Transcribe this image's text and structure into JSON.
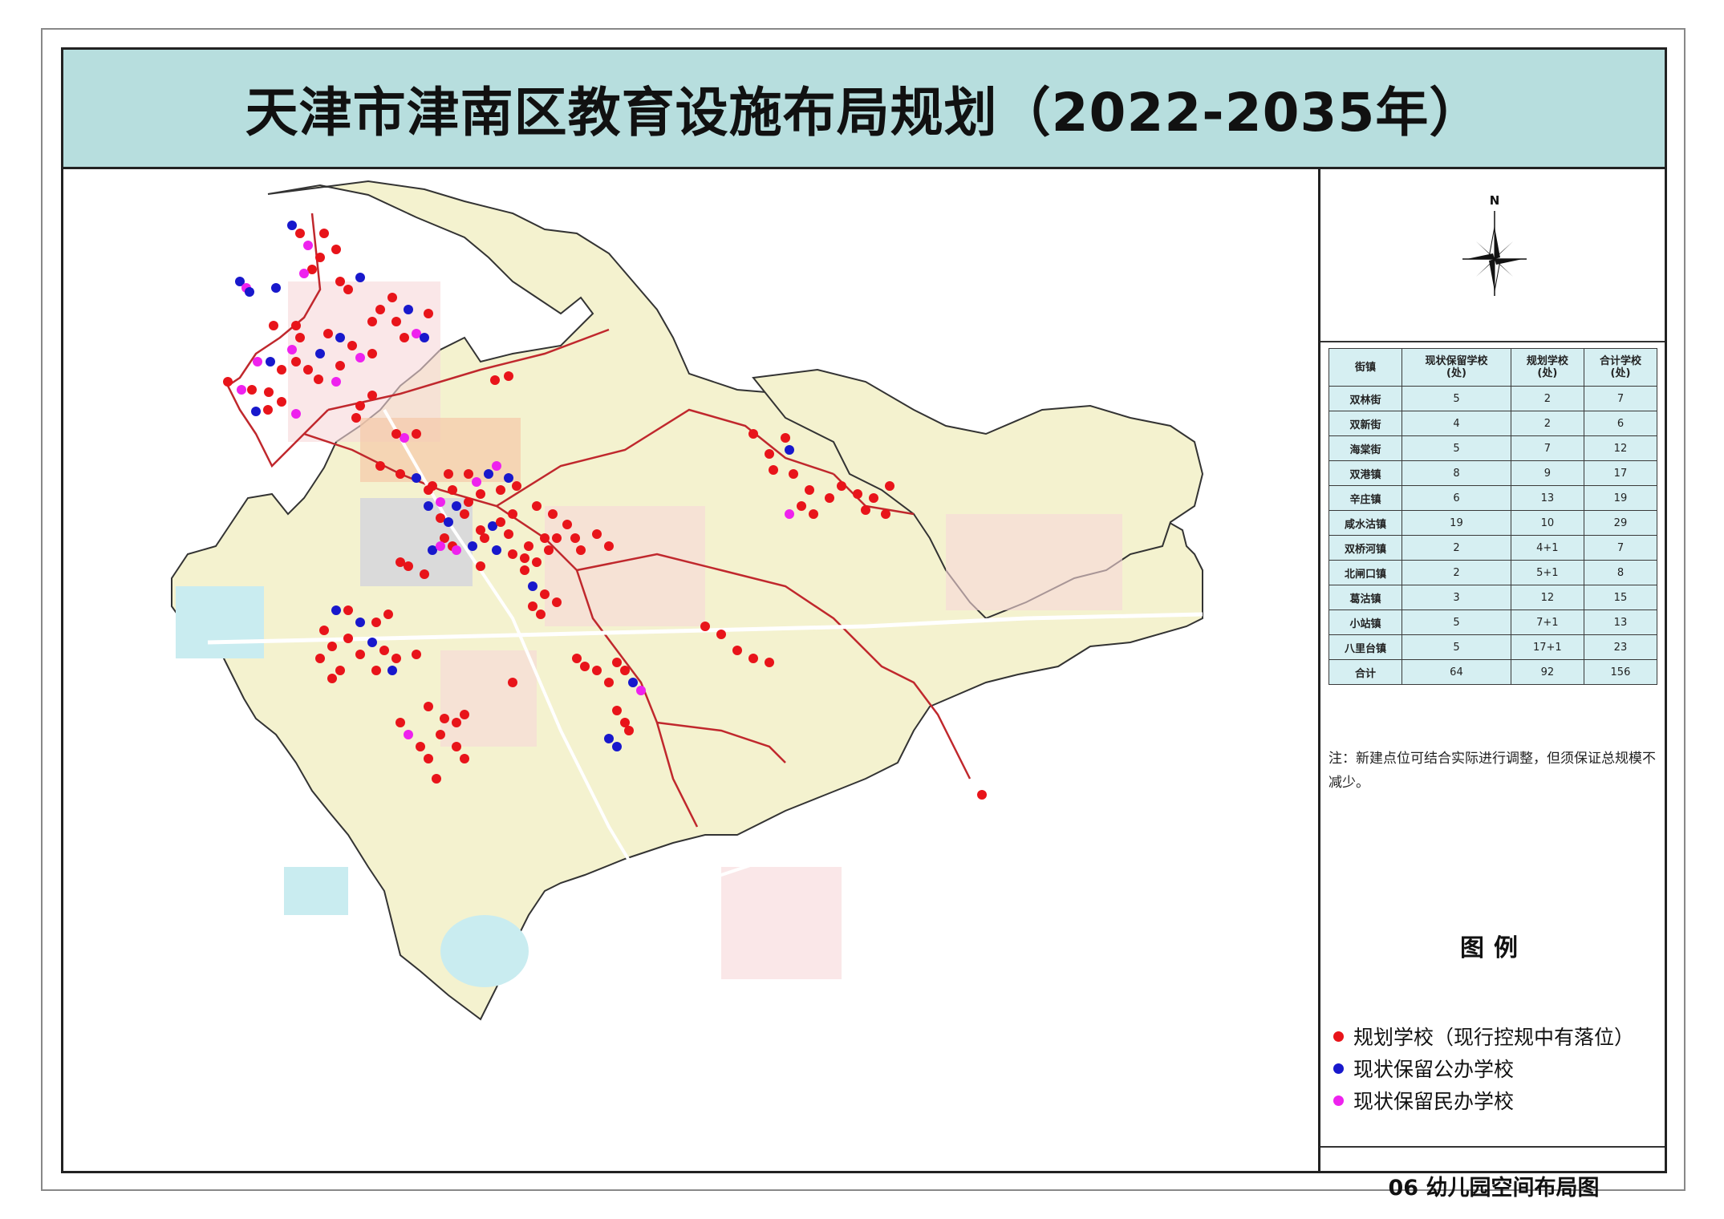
{
  "title": "天津市津南区教育设施布局规划（2022-2035年）",
  "compass": {
    "north_label": "N",
    "icon": "north-arrow-icon"
  },
  "table": {
    "headers": [
      "街镇",
      "现状保留学校\n(处)",
      "规划学校\n(处)",
      "合计学校\n(处)"
    ],
    "rows": [
      [
        "双林街",
        "5",
        "2",
        "7"
      ],
      [
        "双新街",
        "4",
        "2",
        "6"
      ],
      [
        "海棠街",
        "5",
        "7",
        "12"
      ],
      [
        "双港镇",
        "8",
        "9",
        "17"
      ],
      [
        "辛庄镇",
        "6",
        "13",
        "19"
      ],
      [
        "咸水沽镇",
        "19",
        "10",
        "29"
      ],
      [
        "双桥河镇",
        "2",
        "4+1",
        "7"
      ],
      [
        "北闸口镇",
        "2",
        "5+1",
        "8"
      ],
      [
        "葛沽镇",
        "3",
        "12",
        "15"
      ],
      [
        "小站镇",
        "5",
        "7+1",
        "13"
      ],
      [
        "八里台镇",
        "5",
        "17+1",
        "23"
      ],
      [
        "合计",
        "64",
        "92",
        "156"
      ]
    ]
  },
  "note": "注：新建点位可结合实际进行调整，但须保证总规模不减少。",
  "legend": {
    "title": "图例",
    "items": [
      {
        "label": "规划学校（现行控规中有落位）",
        "color": "#e8141a"
      },
      {
        "label": "现状保留公办学校",
        "color": "#1818cc"
      },
      {
        "label": "现状保留民办学校",
        "color": "#ee22ee"
      }
    ]
  },
  "footer": "06 幼儿园空间布局图",
  "colors": {
    "title_bg": "#b7dede",
    "table_bg": "#d6eff2",
    "boundary": "#c0282d",
    "land_base": "#f4f2cf",
    "water": "#c9ecf0"
  }
}
